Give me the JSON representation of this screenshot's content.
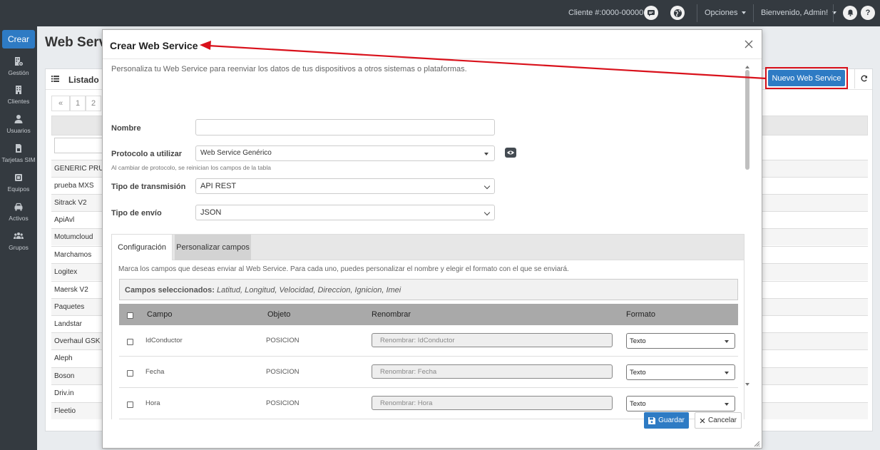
{
  "topbar": {
    "client": "Cliente #:0000-00000",
    "options": "Opciones",
    "welcome": "Bienvenido, Admin!",
    "icons": [
      "chat-icon",
      "globe-icon",
      "bell-icon",
      "help-icon"
    ],
    "help_glyph": "?"
  },
  "sidebar": {
    "create": "Crear",
    "items": [
      {
        "label": "Gestión",
        "icon": "building-gear-icon"
      },
      {
        "label": "Clientes",
        "icon": "building-icon"
      },
      {
        "label": "Usuarios",
        "icon": "user-icon"
      },
      {
        "label": "Tarjetas SIM",
        "icon": "sim-card-icon"
      },
      {
        "label": "Equipos",
        "icon": "device-icon"
      },
      {
        "label": "Activos",
        "icon": "car-icon"
      },
      {
        "label": "Grupos",
        "icon": "users-icon"
      }
    ]
  },
  "main": {
    "page_title": "Web Serv",
    "list_title": "Listado",
    "pager": [
      "«",
      "1",
      "2"
    ],
    "new_button": "Nuevo Web Service",
    "rows": [
      "GENERIC PRU",
      "prueba MXS",
      "Sitrack V2",
      "ApiAvl",
      "Motumcloud",
      "Marchamos",
      "Logitex",
      "Maersk V2",
      "Paquetes",
      "Landstar",
      "Overhaul GSK",
      "Aleph",
      "Boson",
      "Driv.in",
      "Fleetio"
    ]
  },
  "modal": {
    "title": "Crear Web Service",
    "description": "Personaliza tu Web Service para reenviar los datos de tus dispositivos a otros sistemas o plataformas.",
    "nombre_label": "Nombre",
    "nombre_value": "",
    "protocolo_label": "Protocolo a utilizar",
    "protocolo_value": "Web Service Genérico",
    "protocolo_note": "Al cambiar de protocolo, se reinician los campos de la tabla",
    "transmision_label": "Tipo de transmisión",
    "transmision_value": "API REST",
    "envio_label": "Tipo de envío",
    "envio_value": "JSON",
    "tabs": [
      "Configuración",
      "Personalizar campos"
    ],
    "active_tab": "Personalizar campos",
    "tab_description": "Marca los campos que deseas enviar al Web Service. Para cada uno, puedes personalizar el nombre y elegir el formato con el que se enviará.",
    "selected_label": "Campos seleccionados:",
    "selected_fields": "Latitud, Longitud, Velocidad, Direccion, Ignicion, Imei",
    "columns": [
      "Campo",
      "Objeto",
      "Renombrar",
      "Formato"
    ],
    "fields": [
      {
        "campo": "IdConductor",
        "objeto": "POSICION",
        "placeholder": "Renombrar: IdConductor",
        "formato": "Texto"
      },
      {
        "campo": "Fecha",
        "objeto": "POSICION",
        "placeholder": "Renombrar: Fecha",
        "formato": "Texto"
      },
      {
        "campo": "Hora",
        "objeto": "POSICION",
        "placeholder": "Renombrar: Hora",
        "formato": "Texto"
      }
    ],
    "save": "Guardar",
    "cancel": "Cancelar"
  },
  "colors": {
    "topbar": "#343a40",
    "primary": "#2e7bc4",
    "annotation": "#d9111b"
  }
}
